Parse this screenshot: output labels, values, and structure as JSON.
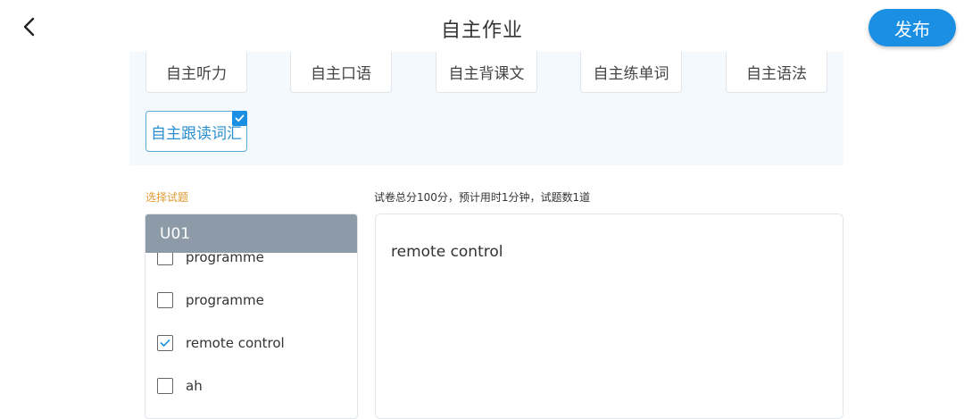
{
  "header": {
    "title": "自主作业",
    "publish_label": "发布"
  },
  "types": [
    {
      "label": "自主听力",
      "selected": false
    },
    {
      "label": "自主口语",
      "selected": false
    },
    {
      "label": "自主背课文",
      "selected": false
    },
    {
      "label": "自主练单词",
      "selected": false
    },
    {
      "label": "自主语法",
      "selected": false
    },
    {
      "label": "自主跟读词汇",
      "selected": true
    }
  ],
  "selection": {
    "label": "选择试题",
    "summary": "试卷总分100分，预计用时1分钟，试题数1道"
  },
  "unit_list": {
    "header": "U01",
    "items": [
      {
        "label": "programme",
        "checked": false
      },
      {
        "label": "programme",
        "checked": false
      },
      {
        "label": "remote control",
        "checked": true
      },
      {
        "label": "ah",
        "checked": false
      }
    ]
  },
  "preview": {
    "text": "remote control"
  },
  "colors": {
    "accent": "#1a8fe3",
    "label_orange": "#e29a2f",
    "list_header": "#8c9ba7",
    "panel_bg": "#f4f9fd"
  }
}
